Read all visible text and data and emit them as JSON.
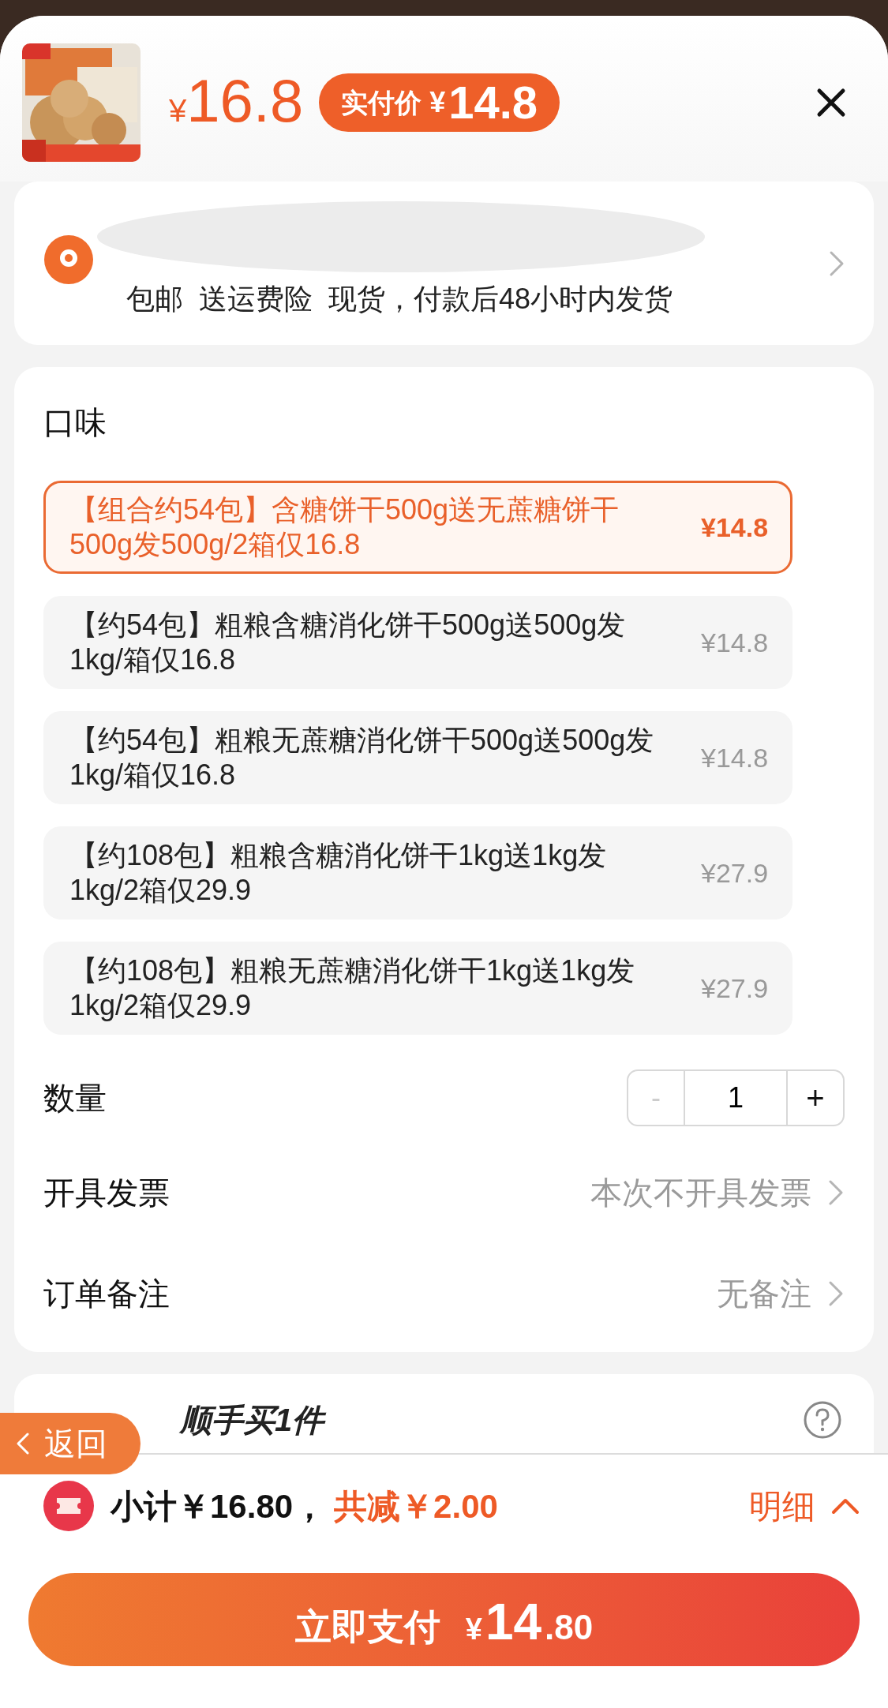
{
  "header": {
    "price_symbol": "¥",
    "price": "16.8",
    "badge_label": "实付价",
    "badge_symbol": "¥",
    "badge_price": "14.8"
  },
  "shipping": {
    "text": "包邮  送运费险  现货，付款后48小时内发货"
  },
  "spec": {
    "title": "口味",
    "options": [
      {
        "label": "【组合约54包】含糖饼干500g送无蔗糖饼干500g发500g/2箱仅16.8",
        "price": "¥14.8",
        "selected": true
      },
      {
        "label": "【约54包】粗粮含糖消化饼干500g送500g发1kg/箱仅16.8",
        "price": "¥14.8",
        "selected": false
      },
      {
        "label": "【约54包】粗粮无蔗糖消化饼干500g送500g发1kg/箱仅16.8",
        "price": "¥14.8",
        "selected": false
      },
      {
        "label": "【约108包】粗粮含糖消化饼干1kg送1kg发1kg/2箱仅29.9",
        "price": "¥27.9",
        "selected": false
      },
      {
        "label": "【约108包】粗粮无蔗糖消化饼干1kg送1kg发1kg/2箱仅29.9",
        "price": "¥27.9",
        "selected": false
      }
    ]
  },
  "quantity": {
    "label": "数量",
    "minus": "-",
    "value": "1",
    "plus": "+",
    "minus_disabled": true
  },
  "rows": [
    {
      "label": "开具发票",
      "value": "本次不开具发票"
    },
    {
      "label": "订单备注",
      "value": "无备注"
    }
  ],
  "addon": {
    "title": "顺手买1件"
  },
  "back_button": {
    "label": "返回"
  },
  "summary": {
    "subtotal": "小计￥16.80，",
    "discount": "共减￥2.00",
    "details": "明细"
  },
  "pay_button": {
    "label": "立即支付",
    "symbol": "¥",
    "integer": "14",
    "decimal": ".80"
  }
}
